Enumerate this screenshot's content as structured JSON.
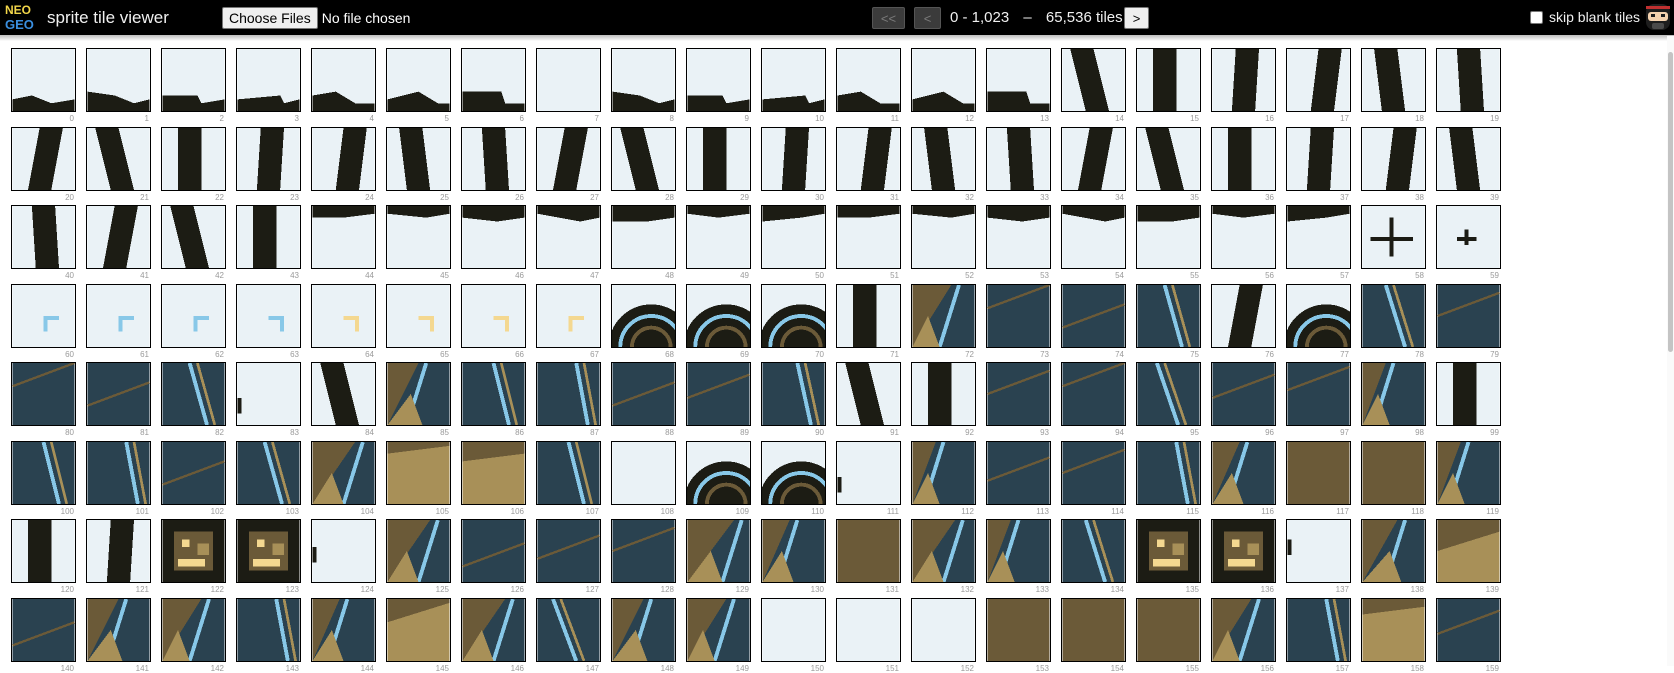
{
  "app": {
    "title": "sprite tile viewer",
    "logo_icon": "neogeo-logo",
    "avatar_icon": "ninja-avatar"
  },
  "file_input": {
    "button_label": "Choose Files",
    "status": "No file chosen"
  },
  "navigation": {
    "first_label": "<<",
    "prev_label": "<",
    "next_label": ">",
    "range_text": "0 - 1,023",
    "range_sep": "–",
    "total_text": "65,536 tiles"
  },
  "options": {
    "skip_blank_label": "skip blank tiles",
    "skip_blank_checked": false
  },
  "palette": {
    "background": "#eaf2f6",
    "dark": "#1c1c14",
    "slate": "#2a4250",
    "olive": "#6b5a38",
    "tan": "#a89058",
    "cyan": "#88c8e8",
    "gold": "#f4d890"
  },
  "tiles": [
    {
      "n": "0",
      "k": "bl-bar"
    },
    {
      "n": "1",
      "k": "bl-bar"
    },
    {
      "n": "2",
      "k": "bl-bar"
    },
    {
      "n": "3",
      "k": "bl-bar"
    },
    {
      "n": "4",
      "k": "bl-bar"
    },
    {
      "n": "5",
      "k": "bl-bar"
    },
    {
      "n": "6",
      "k": "bl-bar"
    },
    {
      "n": "7",
      "k": "blank"
    },
    {
      "n": "8",
      "k": "bl-bar"
    },
    {
      "n": "9",
      "k": "bl-bar"
    },
    {
      "n": "10",
      "k": "bl-bar"
    },
    {
      "n": "11",
      "k": "bl-bar"
    },
    {
      "n": "12",
      "k": "bl-bar"
    },
    {
      "n": "13",
      "k": "bl-bar"
    },
    {
      "n": "14",
      "k": "bl-stroke"
    },
    {
      "n": "15",
      "k": "bl-stroke"
    },
    {
      "n": "16",
      "k": "bl-stroke"
    },
    {
      "n": "17",
      "k": "bl-stroke"
    },
    {
      "n": "18",
      "k": "bl-stroke"
    },
    {
      "n": "19",
      "k": "bl-stroke"
    },
    {
      "n": "20",
      "k": "bl-stroke"
    },
    {
      "n": "21",
      "k": "bl-stroke"
    },
    {
      "n": "22",
      "k": "bl-stroke"
    },
    {
      "n": "23",
      "k": "bl-stroke"
    },
    {
      "n": "24",
      "k": "bl-stroke"
    },
    {
      "n": "25",
      "k": "bl-stroke"
    },
    {
      "n": "26",
      "k": "bl-stroke"
    },
    {
      "n": "27",
      "k": "bl-stroke"
    },
    {
      "n": "28",
      "k": "bl-stroke"
    },
    {
      "n": "29",
      "k": "bl-stroke"
    },
    {
      "n": "30",
      "k": "bl-stroke"
    },
    {
      "n": "31",
      "k": "bl-stroke"
    },
    {
      "n": "32",
      "k": "bl-stroke"
    },
    {
      "n": "33",
      "k": "bl-stroke"
    },
    {
      "n": "34",
      "k": "bl-stroke"
    },
    {
      "n": "35",
      "k": "bl-stroke"
    },
    {
      "n": "36",
      "k": "bl-stroke"
    },
    {
      "n": "37",
      "k": "bl-stroke"
    },
    {
      "n": "38",
      "k": "bl-stroke"
    },
    {
      "n": "39",
      "k": "bl-stroke"
    },
    {
      "n": "40",
      "k": "bl-stroke"
    },
    {
      "n": "41",
      "k": "bl-stroke"
    },
    {
      "n": "42",
      "k": "bl-stroke"
    },
    {
      "n": "43",
      "k": "bl-stroke"
    },
    {
      "n": "44",
      "k": "bl-top"
    },
    {
      "n": "45",
      "k": "bl-top"
    },
    {
      "n": "46",
      "k": "bl-top"
    },
    {
      "n": "47",
      "k": "bl-top"
    },
    {
      "n": "48",
      "k": "bl-top"
    },
    {
      "n": "49",
      "k": "bl-top"
    },
    {
      "n": "50",
      "k": "bl-top"
    },
    {
      "n": "51",
      "k": "bl-top"
    },
    {
      "n": "52",
      "k": "bl-top"
    },
    {
      "n": "53",
      "k": "bl-top"
    },
    {
      "n": "54",
      "k": "bl-top"
    },
    {
      "n": "55",
      "k": "bl-top"
    },
    {
      "n": "56",
      "k": "bl-top"
    },
    {
      "n": "57",
      "k": "bl-top"
    },
    {
      "n": "58",
      "k": "cross"
    },
    {
      "n": "59",
      "k": "cross-s"
    },
    {
      "n": "60",
      "k": "corner-c"
    },
    {
      "n": "61",
      "k": "corner-c"
    },
    {
      "n": "62",
      "k": "corner-c"
    },
    {
      "n": "63",
      "k": "corner-c"
    },
    {
      "n": "64",
      "k": "corner-g"
    },
    {
      "n": "65",
      "k": "corner-g"
    },
    {
      "n": "66",
      "k": "corner-g"
    },
    {
      "n": "67",
      "k": "corner-g"
    },
    {
      "n": "68",
      "k": "wheel"
    },
    {
      "n": "69",
      "k": "wheel"
    },
    {
      "n": "70",
      "k": "wheel"
    },
    {
      "n": "71",
      "k": "bl-stroke"
    },
    {
      "n": "72",
      "k": "tan-mix"
    },
    {
      "n": "73",
      "k": "slate"
    },
    {
      "n": "74",
      "k": "slate"
    },
    {
      "n": "75",
      "k": "slate-line"
    },
    {
      "n": "76",
      "k": "bl-stroke"
    },
    {
      "n": "77",
      "k": "wheel"
    },
    {
      "n": "78",
      "k": "slate-line"
    },
    {
      "n": "79",
      "k": "slate"
    },
    {
      "n": "80",
      "k": "slate"
    },
    {
      "n": "81",
      "k": "slate"
    },
    {
      "n": "82",
      "k": "slate-line"
    },
    {
      "n": "83",
      "k": "blank-dot"
    },
    {
      "n": "84",
      "k": "bl-stroke"
    },
    {
      "n": "85",
      "k": "tan-mix"
    },
    {
      "n": "86",
      "k": "slate-line"
    },
    {
      "n": "87",
      "k": "slate-line"
    },
    {
      "n": "88",
      "k": "slate"
    },
    {
      "n": "89",
      "k": "slate"
    },
    {
      "n": "90",
      "k": "slate-line"
    },
    {
      "n": "91",
      "k": "bl-stroke"
    },
    {
      "n": "92",
      "k": "bl-stroke"
    },
    {
      "n": "93",
      "k": "slate"
    },
    {
      "n": "94",
      "k": "slate"
    },
    {
      "n": "95",
      "k": "slate-line"
    },
    {
      "n": "96",
      "k": "slate"
    },
    {
      "n": "97",
      "k": "slate"
    },
    {
      "n": "98",
      "k": "tan-mix"
    },
    {
      "n": "99",
      "k": "bl-stroke"
    },
    {
      "n": "100",
      "k": "slate-line"
    },
    {
      "n": "101",
      "k": "slate-line"
    },
    {
      "n": "102",
      "k": "slate"
    },
    {
      "n": "103",
      "k": "slate-line"
    },
    {
      "n": "104",
      "k": "tan-mix"
    },
    {
      "n": "105",
      "k": "tan"
    },
    {
      "n": "106",
      "k": "tan"
    },
    {
      "n": "107",
      "k": "slate-line"
    },
    {
      "n": "108",
      "k": "blank"
    },
    {
      "n": "109",
      "k": "wheel"
    },
    {
      "n": "110",
      "k": "wheel"
    },
    {
      "n": "111",
      "k": "blank-dot"
    },
    {
      "n": "112",
      "k": "tan-mix"
    },
    {
      "n": "113",
      "k": "slate"
    },
    {
      "n": "114",
      "k": "slate"
    },
    {
      "n": "115",
      "k": "slate-line"
    },
    {
      "n": "116",
      "k": "tan-mix"
    },
    {
      "n": "117",
      "k": "olive"
    },
    {
      "n": "118",
      "k": "olive"
    },
    {
      "n": "119",
      "k": "tan-mix"
    },
    {
      "n": "120",
      "k": "bl-stroke"
    },
    {
      "n": "121",
      "k": "bl-stroke"
    },
    {
      "n": "122",
      "k": "face"
    },
    {
      "n": "123",
      "k": "face"
    },
    {
      "n": "124",
      "k": "blank-dot"
    },
    {
      "n": "125",
      "k": "tan-mix"
    },
    {
      "n": "126",
      "k": "slate"
    },
    {
      "n": "127",
      "k": "slate"
    },
    {
      "n": "128",
      "k": "slate"
    },
    {
      "n": "129",
      "k": "tan-mix"
    },
    {
      "n": "130",
      "k": "tan-mix"
    },
    {
      "n": "131",
      "k": "olive"
    },
    {
      "n": "132",
      "k": "tan-mix"
    },
    {
      "n": "133",
      "k": "tan-mix"
    },
    {
      "n": "134",
      "k": "slate-line"
    },
    {
      "n": "135",
      "k": "face"
    },
    {
      "n": "136",
      "k": "face"
    },
    {
      "n": "137",
      "k": "blank-dot"
    },
    {
      "n": "138",
      "k": "tan-mix"
    },
    {
      "n": "139",
      "k": "tan"
    },
    {
      "n": "140",
      "k": "slate"
    },
    {
      "n": "141",
      "k": "tan-mix"
    },
    {
      "n": "142",
      "k": "tan-mix"
    },
    {
      "n": "143",
      "k": "slate-line"
    },
    {
      "n": "144",
      "k": "tan-mix"
    },
    {
      "n": "145",
      "k": "tan"
    },
    {
      "n": "146",
      "k": "tan-mix"
    },
    {
      "n": "147",
      "k": "slate-line"
    },
    {
      "n": "148",
      "k": "tan-mix"
    },
    {
      "n": "149",
      "k": "tan-mix"
    },
    {
      "n": "150",
      "k": "blank"
    },
    {
      "n": "151",
      "k": "blank"
    },
    {
      "n": "152",
      "k": "blank"
    },
    {
      "n": "153",
      "k": "olive"
    },
    {
      "n": "154",
      "k": "olive"
    },
    {
      "n": "155",
      "k": "olive"
    },
    {
      "n": "156",
      "k": "tan-mix"
    },
    {
      "n": "157",
      "k": "slate-line"
    },
    {
      "n": "158",
      "k": "tan"
    },
    {
      "n": "159",
      "k": "slate"
    }
  ]
}
